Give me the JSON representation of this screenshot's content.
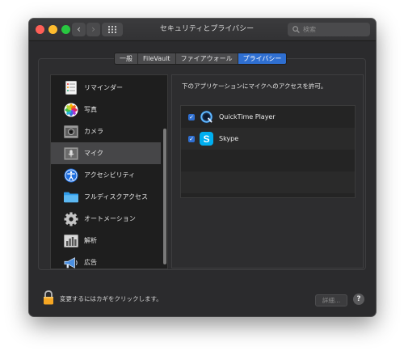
{
  "window": {
    "title": "セキュリティとプライバシー"
  },
  "toolbar": {
    "back_icon": "chevron-left-icon",
    "forward_icon": "chevron-right-icon",
    "grid_icon": "grid-icon",
    "search_placeholder": "検索"
  },
  "tabs": [
    {
      "label": "一般",
      "active": false
    },
    {
      "label": "FileVault",
      "active": false
    },
    {
      "label": "ファイアウォール",
      "active": false
    },
    {
      "label": "プライバシー",
      "active": true
    }
  ],
  "sidebar": {
    "items": [
      {
        "label": "リマインダー",
        "icon": "reminders-icon",
        "selected": false
      },
      {
        "label": "写真",
        "icon": "photos-icon",
        "selected": false
      },
      {
        "label": "カメラ",
        "icon": "camera-icon",
        "selected": false
      },
      {
        "label": "マイク",
        "icon": "microphone-icon",
        "selected": true
      },
      {
        "label": "アクセシビリティ",
        "icon": "accessibility-icon",
        "selected": false
      },
      {
        "label": "フルディスクアクセス",
        "icon": "folder-icon",
        "selected": false
      },
      {
        "label": "オートメーション",
        "icon": "gear-icon",
        "selected": false
      },
      {
        "label": "解析",
        "icon": "analytics-icon",
        "selected": false
      },
      {
        "label": "広告",
        "icon": "megaphone-icon",
        "selected": false
      }
    ]
  },
  "main": {
    "prompt": "下のアプリケーションにマイクへのアクセスを許可。",
    "apps": [
      {
        "name": "QuickTime Player",
        "checked": true,
        "icon": "quicktime-icon"
      },
      {
        "name": "Skype",
        "checked": true,
        "icon": "skype-icon"
      }
    ]
  },
  "footer": {
    "lock_text": "変更するにはカギをクリックします。",
    "advanced_label": "詳細...",
    "help_label": "?"
  },
  "colors": {
    "accent": "#2f6fd1",
    "window_bg": "#2b2b2d",
    "lock": "#f5a623"
  }
}
